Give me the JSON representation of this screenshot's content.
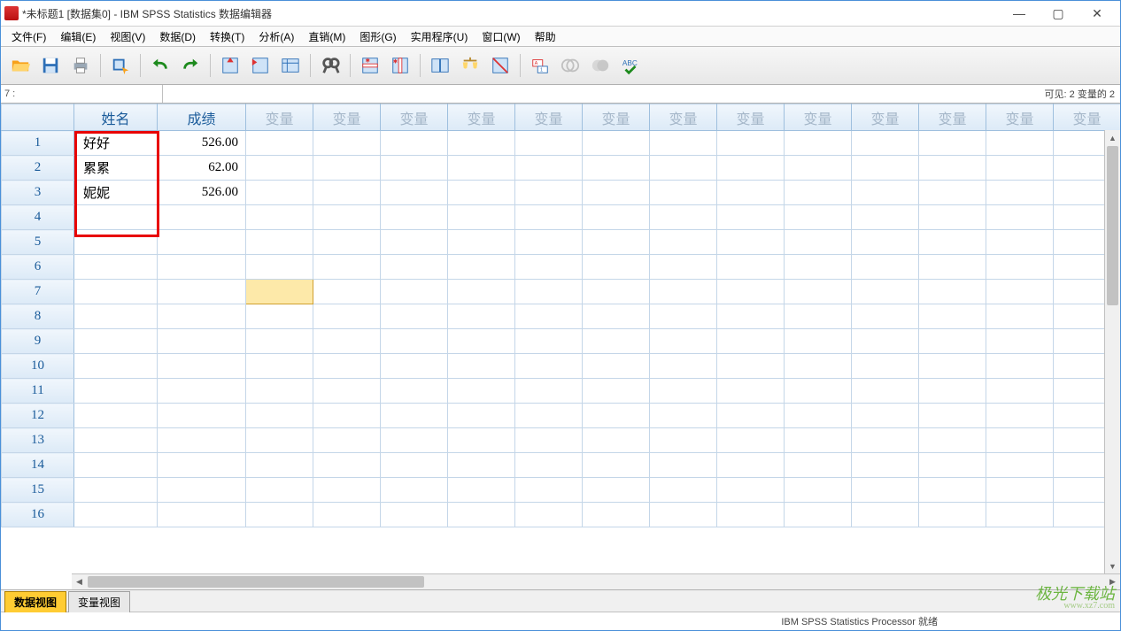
{
  "window": {
    "title": "*未标题1 [数据集0] - IBM SPSS Statistics 数据编辑器",
    "min": "—",
    "max": "▢",
    "close": "✕"
  },
  "menu": {
    "file": "文件(F)",
    "edit": "编辑(E)",
    "view": "视图(V)",
    "data": "数据(D)",
    "transform": "转换(T)",
    "analyze": "分析(A)",
    "direct": "直销(M)",
    "graphs": "图形(G)",
    "utilities": "实用程序(U)",
    "window": "窗口(W)",
    "help": "帮助"
  },
  "toolbar": {
    "open": "open-file",
    "save": "save",
    "print": "print",
    "recall": "recall-dialog",
    "undo": "undo",
    "redo": "redo",
    "goto_case": "goto-case",
    "goto_var": "goto-variable",
    "variables": "variables",
    "find": "find",
    "insert_case": "insert-case",
    "insert_var": "insert-variable",
    "split": "split-file",
    "weight": "weight-cases",
    "select": "select-cases",
    "value_labels": "value-labels",
    "use_sets": "use-variable-sets",
    "show_all": "show-all-variables",
    "spellcheck": "spell-check"
  },
  "cellbar": {
    "address": "7 :",
    "value": "",
    "visible": "可见:  2 变量的 2"
  },
  "columns": {
    "name": "姓名",
    "score": "成绩",
    "empty": "变量"
  },
  "rows": [
    {
      "n": "1",
      "name": "好好",
      "score": "526.00"
    },
    {
      "n": "2",
      "name": "累累",
      "score": "62.00"
    },
    {
      "n": "3",
      "name": "妮妮",
      "score": "526.00"
    },
    {
      "n": "4",
      "name": "",
      "score": ""
    },
    {
      "n": "5",
      "name": "",
      "score": ""
    },
    {
      "n": "6",
      "name": "",
      "score": ""
    },
    {
      "n": "7",
      "name": "",
      "score": ""
    },
    {
      "n": "8",
      "name": "",
      "score": ""
    },
    {
      "n": "9",
      "name": "",
      "score": ""
    },
    {
      "n": "10",
      "name": "",
      "score": ""
    },
    {
      "n": "11",
      "name": "",
      "score": ""
    },
    {
      "n": "12",
      "name": "",
      "score": ""
    },
    {
      "n": "13",
      "name": "",
      "score": ""
    },
    {
      "n": "14",
      "name": "",
      "score": ""
    },
    {
      "n": "15",
      "name": "",
      "score": ""
    },
    {
      "n": "16",
      "name": "",
      "score": ""
    }
  ],
  "tabs": {
    "data_view": "数据视图",
    "variable_view": "变量视图"
  },
  "status": {
    "processor": "IBM SPSS Statistics Processor 就绪"
  },
  "watermark": {
    "brand": "极光下载站",
    "url": "www.xz7.com"
  },
  "selected_cell": {
    "row": 7,
    "col": 3
  }
}
